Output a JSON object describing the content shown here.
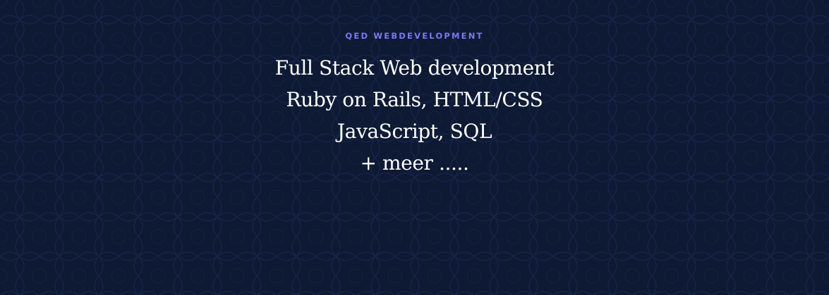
{
  "hero": {
    "eyebrow": "QED WEBDEVELOPMENT",
    "lines": [
      "Full Stack Web development",
      "Ruby on Rails, HTML/CSS",
      "JavaScript, SQL",
      "+ meer ....."
    ]
  },
  "colors": {
    "background": "#0e1a33",
    "accent": "#7b78f0",
    "text": "#ffffff"
  }
}
